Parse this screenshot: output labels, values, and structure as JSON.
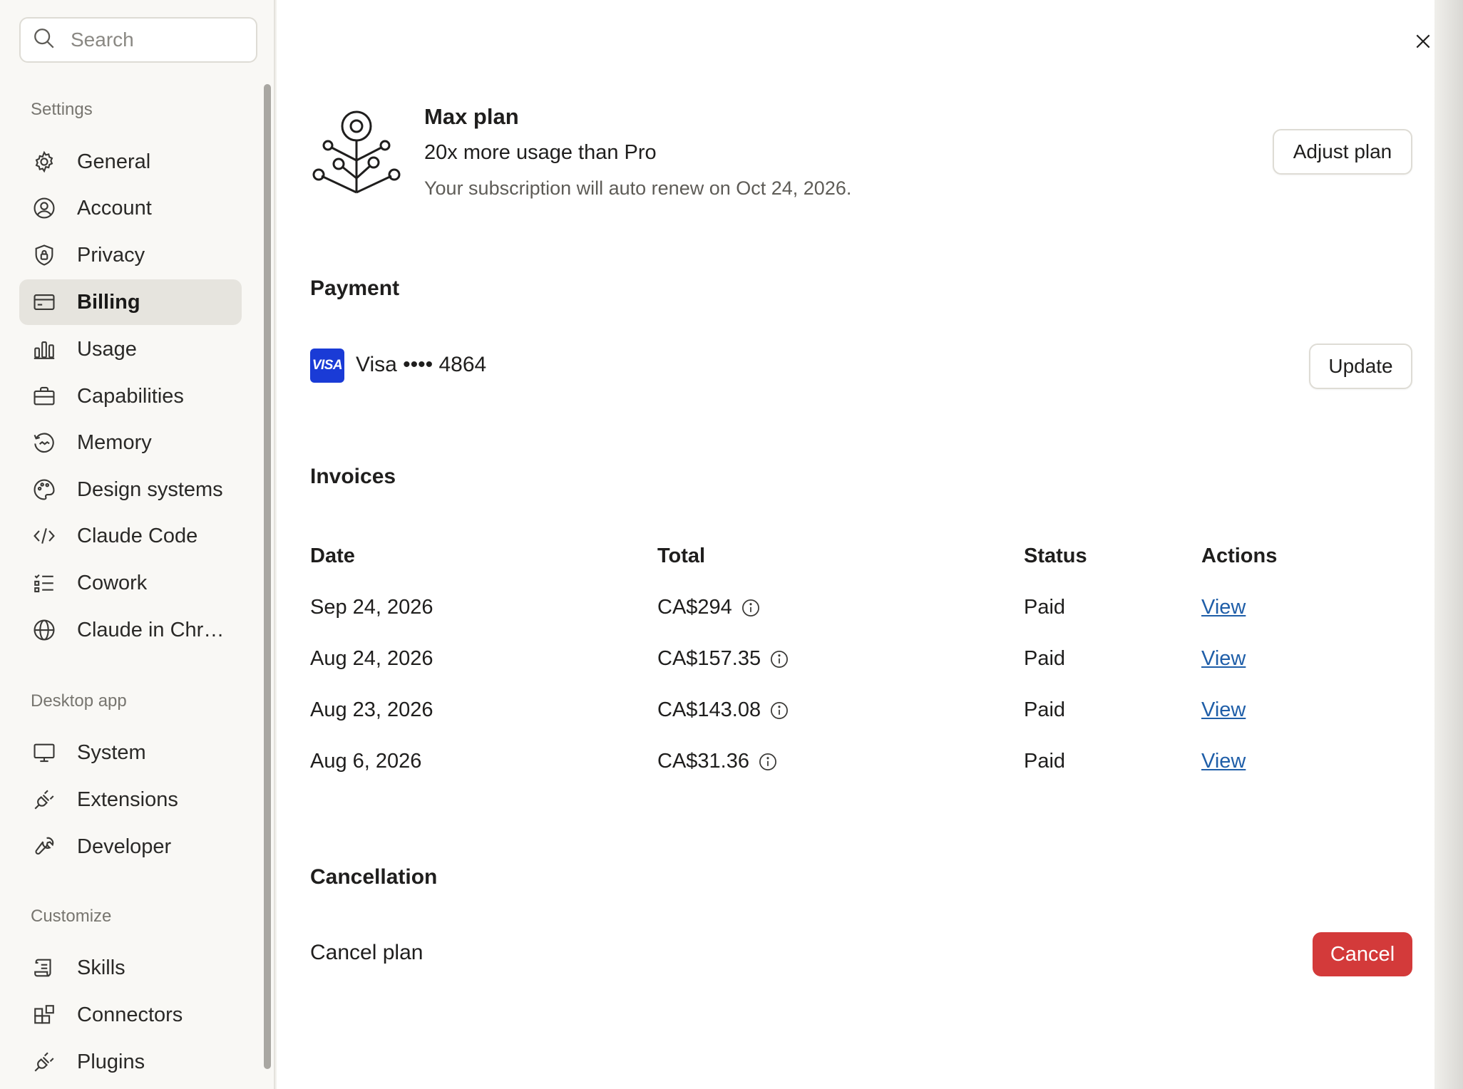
{
  "search": {
    "placeholder": "Search"
  },
  "sidebar": {
    "sections": [
      {
        "label": "Settings",
        "items": [
          {
            "label": "General",
            "icon": "gear-icon"
          },
          {
            "label": "Account",
            "icon": "user-circle-icon"
          },
          {
            "label": "Privacy",
            "icon": "shield-lock-icon"
          },
          {
            "label": "Billing",
            "icon": "credit-card-icon",
            "active": true
          },
          {
            "label": "Usage",
            "icon": "bar-chart-icon"
          },
          {
            "label": "Capabilities",
            "icon": "briefcase-icon"
          },
          {
            "label": "Memory",
            "icon": "memory-icon"
          },
          {
            "label": "Design systems",
            "icon": "palette-icon"
          },
          {
            "label": "Claude Code",
            "icon": "code-icon"
          },
          {
            "label": "Cowork",
            "icon": "checklist-icon"
          },
          {
            "label": "Claude in Chr…",
            "icon": "globe-icon"
          }
        ]
      },
      {
        "label": "Desktop app",
        "items": [
          {
            "label": "System",
            "icon": "monitor-icon"
          },
          {
            "label": "Extensions",
            "icon": "plug-icon"
          },
          {
            "label": "Developer",
            "icon": "wrench-icon"
          }
        ]
      },
      {
        "label": "Customize",
        "items": [
          {
            "label": "Skills",
            "icon": "scroll-icon"
          },
          {
            "label": "Connectors",
            "icon": "blocks-icon"
          },
          {
            "label": "Plugins",
            "icon": "plug-icon"
          }
        ]
      }
    ]
  },
  "plan": {
    "title": "Max plan",
    "subtitle": "20x more usage than Pro",
    "renewal": "Your subscription will auto renew on Oct 24, 2026.",
    "adjust_label": "Adjust plan"
  },
  "payment": {
    "heading": "Payment",
    "card_brand": "VISA",
    "card_text": "Visa •••• 4864",
    "update_label": "Update"
  },
  "invoices": {
    "heading": "Invoices",
    "columns": [
      "Date",
      "Total",
      "Status",
      "Actions"
    ],
    "rows": [
      {
        "date": "Sep 24, 2026",
        "total": "CA$294",
        "status": "Paid",
        "action": "View"
      },
      {
        "date": "Aug 24, 2026",
        "total": "CA$157.35",
        "status": "Paid",
        "action": "View"
      },
      {
        "date": "Aug 23, 2026",
        "total": "CA$143.08",
        "status": "Paid",
        "action": "View"
      },
      {
        "date": "Aug 6, 2026",
        "total": "CA$31.36",
        "status": "Paid",
        "action": "View"
      }
    ]
  },
  "cancellation": {
    "heading": "Cancellation",
    "label": "Cancel plan",
    "button_label": "Cancel"
  },
  "colors": {
    "accent_link": "#1f5ea8",
    "danger": "#d33a3a",
    "visa": "#1a3bd6",
    "active_nav": "#e6e4de"
  }
}
